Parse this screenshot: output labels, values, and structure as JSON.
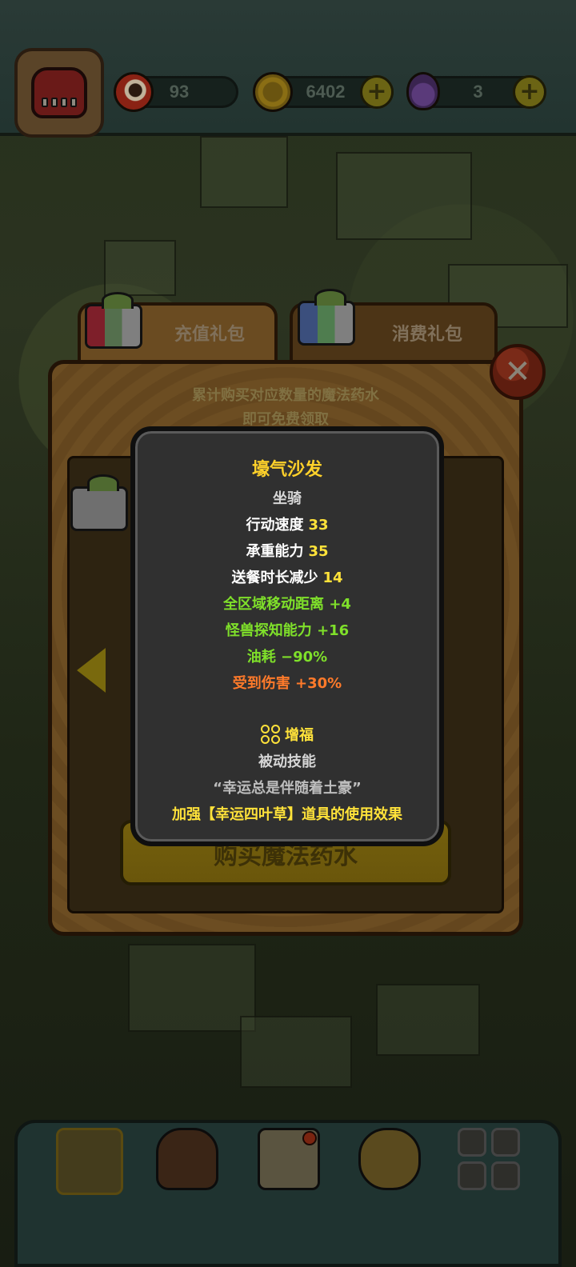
{
  "hud": {
    "eyes": "93",
    "coins": "6402",
    "potions": "3",
    "plus": "+"
  },
  "gift_panel": {
    "tabs": [
      "充值礼包",
      "消费礼包"
    ],
    "note_line1": "累计购买对应数量的魔法药水",
    "note_line2": "即可免费领取",
    "buy_button": "购买魔法药水",
    "close": "✕"
  },
  "tooltip": {
    "name": "壕气沙发",
    "type": "坐骑",
    "stats": [
      {
        "label": "行动速度",
        "value": "33"
      },
      {
        "label": "承重能力",
        "value": "35"
      },
      {
        "label": "送餐时长减少",
        "value": "14"
      }
    ],
    "bonuses": [
      "全区域移动距离 +4",
      "怪兽探知能力 +16",
      "油耗 −90%"
    ],
    "penalty": "受到伤害 +30%",
    "skill_name": "增福",
    "skill_type": "被动技能",
    "skill_quote": "“幸运总是伴随着土豪”",
    "skill_effect": "加强【幸运四叶草】道具的使用效果"
  },
  "colors": {
    "title_yellow": "#ffd12a",
    "value_yellow": "#ffe23a",
    "bonus_green": "#7fe02a",
    "penalty_orange": "#ff7a2a",
    "tooltip_bg": "#303030"
  },
  "icons": {
    "avatar": "monster-avatar-icon",
    "res1": "eyeball-icon",
    "res2": "coin-icon",
    "res3": "potion-icon",
    "skill": "four-leaf-clover-icon"
  }
}
